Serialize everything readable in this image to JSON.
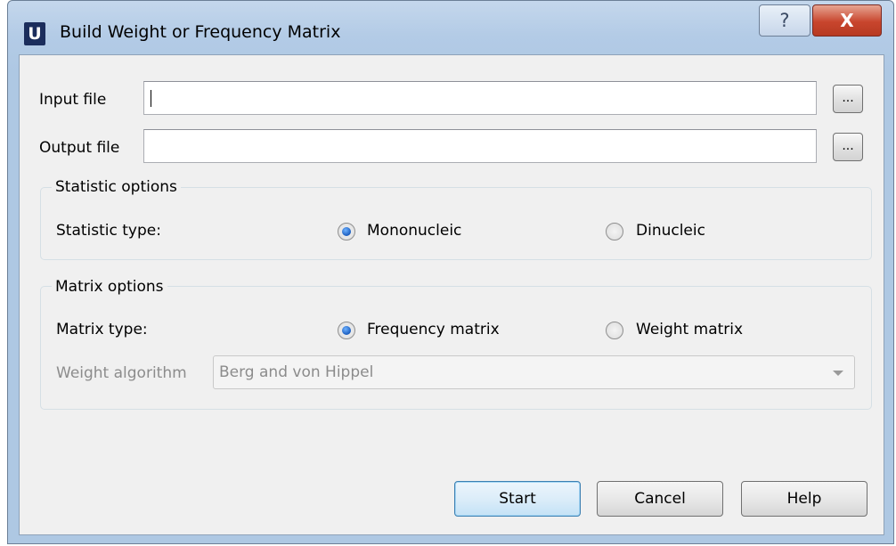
{
  "window": {
    "title": "Build Weight or Frequency Matrix",
    "app_icon_letter": "U",
    "help_glyph": "?",
    "close_glyph": "X"
  },
  "files": {
    "input_label": "Input file",
    "input_value": "",
    "input_browse": "...",
    "output_label": "Output file",
    "output_value": "",
    "output_browse": "..."
  },
  "statistic_options": {
    "title": "Statistic options",
    "type_label": "Statistic type:",
    "options": [
      {
        "label": "Mononucleic",
        "checked": true
      },
      {
        "label": "Dinucleic",
        "checked": false
      }
    ]
  },
  "matrix_options": {
    "title": "Matrix options",
    "type_label": "Matrix type:",
    "options": [
      {
        "label": "Frequency matrix",
        "checked": true
      },
      {
        "label": "Weight matrix",
        "checked": false
      }
    ],
    "algorithm_label": "Weight algorithm",
    "algorithm_value": "Berg and von Hippel",
    "algorithm_enabled": false
  },
  "buttons": {
    "start": "Start",
    "cancel": "Cancel",
    "help": "Help"
  },
  "colors": {
    "titlebar": "#b3cbe6",
    "close": "#c8452d",
    "client_bg": "#f0f0f0",
    "radio_dot": "#1a5dbf"
  },
  "icons": {
    "app": "app-logo-icon",
    "help": "question-mark-icon",
    "close": "close-icon",
    "dropdown": "chevron-down-icon"
  }
}
